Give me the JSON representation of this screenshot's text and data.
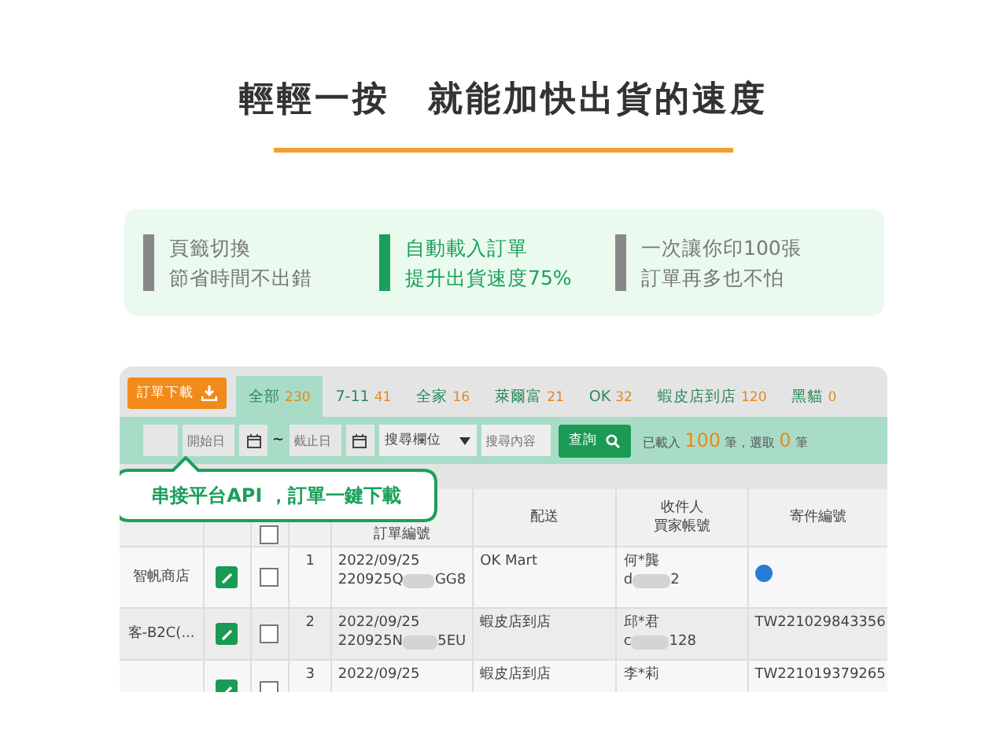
{
  "headline": "輕輕一按　就能加快出貨的速度",
  "features": [
    {
      "lines": [
        "頁籤切換",
        "節省時間不出錯"
      ],
      "highlighted": false
    },
    {
      "lines": [
        "自動載入訂單",
        "提升出貨速度75%"
      ],
      "highlighted": true
    },
    {
      "lines": [
        "一次讓你印100張",
        "訂單再多也不怕"
      ],
      "highlighted": false
    }
  ],
  "download_button": "訂單下載",
  "tabs": [
    {
      "label": "全部",
      "count": "230",
      "selected": true
    },
    {
      "label": "7-11",
      "count": "41",
      "selected": false
    },
    {
      "label": "全家",
      "count": "16",
      "selected": false
    },
    {
      "label": "萊爾富",
      "count": "21",
      "selected": false
    },
    {
      "label": "OK",
      "count": "32",
      "selected": false
    },
    {
      "label": "蝦皮店到店",
      "count": "120",
      "selected": false
    },
    {
      "label": "黑貓",
      "count": "0",
      "selected": false
    }
  ],
  "filters": {
    "start_date": {
      "placeholder": "開始日"
    },
    "separator": "~",
    "end_date": {
      "placeholder": "截止日"
    },
    "field_select": "搜尋欄位",
    "search": {
      "placeholder": "搜尋內容"
    },
    "query_button": "查詢",
    "summary": {
      "prefix": "已載入",
      "loaded": "100",
      "middle": "筆，選取",
      "selected": "0",
      "suffix": "筆"
    }
  },
  "callout": "串接平台API ，訂單一鍵下載",
  "table": {
    "select_all_checked": false,
    "columns": [
      [
        "訂單編號"
      ],
      [
        "配送"
      ],
      [
        "收件人",
        "買家帳號"
      ],
      [
        "寄件編號"
      ]
    ],
    "rows": [
      {
        "store": "智帆商店",
        "checked": false,
        "index": "1",
        "date": "2022/09/25",
        "id_start": "220925Q",
        "id_end": "GG8",
        "shipping": "OK Mart",
        "recipient": "何*龔",
        "account_start": "d",
        "account_end": "2",
        "has_badge": true
      },
      {
        "store": "客-B2C(...",
        "checked": false,
        "index": "2",
        "date": "2022/09/25",
        "id_start": "220925N",
        "id_end": "5EU",
        "shipping": "蝦皮店到店",
        "recipient": "邱*君",
        "account_start": "c",
        "account_end": "128",
        "tracking": "TW221029843356",
        "has_badge": false
      },
      {
        "checked": false,
        "index": "3",
        "date": "2022/09/25",
        "shipping": "蝦皮店到店",
        "recipient": "李*莉",
        "tracking": "TW221019379265",
        "has_badge": false
      }
    ]
  }
}
